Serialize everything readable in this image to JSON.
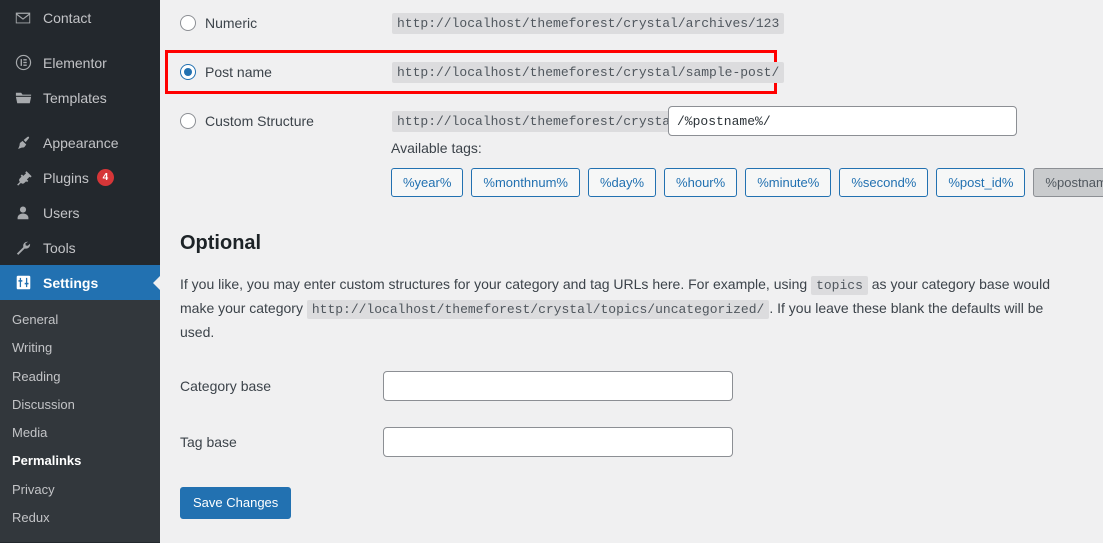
{
  "sidebar": {
    "items": [
      {
        "label": "Contact",
        "icon": "envelope-icon",
        "current": false,
        "badge": null
      },
      {
        "label": "Elementor",
        "icon": "elementor-icon",
        "current": false,
        "badge": null
      },
      {
        "label": "Templates",
        "icon": "folder-icon",
        "current": false,
        "badge": null
      },
      {
        "label": "Appearance",
        "icon": "brush-icon",
        "current": false,
        "badge": null
      },
      {
        "label": "Plugins",
        "icon": "plug-icon",
        "current": false,
        "badge": "4"
      },
      {
        "label": "Users",
        "icon": "user-icon",
        "current": false,
        "badge": null
      },
      {
        "label": "Tools",
        "icon": "wrench-icon",
        "current": false,
        "badge": null
      },
      {
        "label": "Settings",
        "icon": "sliders-icon",
        "current": true,
        "badge": null
      }
    ],
    "submenu": [
      {
        "label": "General",
        "current": false
      },
      {
        "label": "Writing",
        "current": false
      },
      {
        "label": "Reading",
        "current": false
      },
      {
        "label": "Discussion",
        "current": false
      },
      {
        "label": "Media",
        "current": false
      },
      {
        "label": "Permalinks",
        "current": true
      },
      {
        "label": "Privacy",
        "current": false
      },
      {
        "label": "Redux",
        "current": false
      }
    ],
    "colors": {
      "background": "#23282d",
      "submenu_background": "#32373c",
      "current_highlight": "#2271b1",
      "badge": "#d63638"
    }
  },
  "permalinks": {
    "options": [
      {
        "label": "Numeric",
        "url": "http://localhost/themeforest/crystal/archives/123",
        "selected": false,
        "highlighted": false
      },
      {
        "label": "Post name",
        "url": "http://localhost/themeforest/crystal/sample-post/",
        "selected": true,
        "highlighted": true
      },
      {
        "label": "Custom Structure",
        "url": "http://localhost/themeforest/crystal",
        "selected": false,
        "highlighted": false
      }
    ],
    "custom_structure_value": "/%postname%/",
    "custom_structure_placeholder": "",
    "available_tags_label": "Available tags:",
    "available_tags": [
      {
        "label": "%year%",
        "disabled": false
      },
      {
        "label": "%monthnum%",
        "disabled": false
      },
      {
        "label": "%day%",
        "disabled": false
      },
      {
        "label": "%hour%",
        "disabled": false
      },
      {
        "label": "%minute%",
        "disabled": false
      },
      {
        "label": "%second%",
        "disabled": false
      },
      {
        "label": "%post_id%",
        "disabled": false
      },
      {
        "label": "%postname%",
        "disabled": true
      }
    ],
    "highlight_color": "#ff0000"
  },
  "optional": {
    "title": "Optional",
    "desc_part1": "If you like, you may enter custom structures for your category and tag URLs here. For example, using ",
    "desc_code1": "topics",
    "desc_part2": " as your category base would make your category ",
    "desc_code2": "http://localhost/themeforest/crystal/topics/uncategorized/",
    "desc_part3": ". If you leave these blank the defaults will be used.",
    "fields": [
      {
        "label": "Category base",
        "value": "",
        "placeholder": ""
      },
      {
        "label": "Tag base",
        "value": "",
        "placeholder": ""
      }
    ]
  },
  "actions": {
    "save_label": "Save Changes",
    "primary_color": "#2271b1"
  }
}
